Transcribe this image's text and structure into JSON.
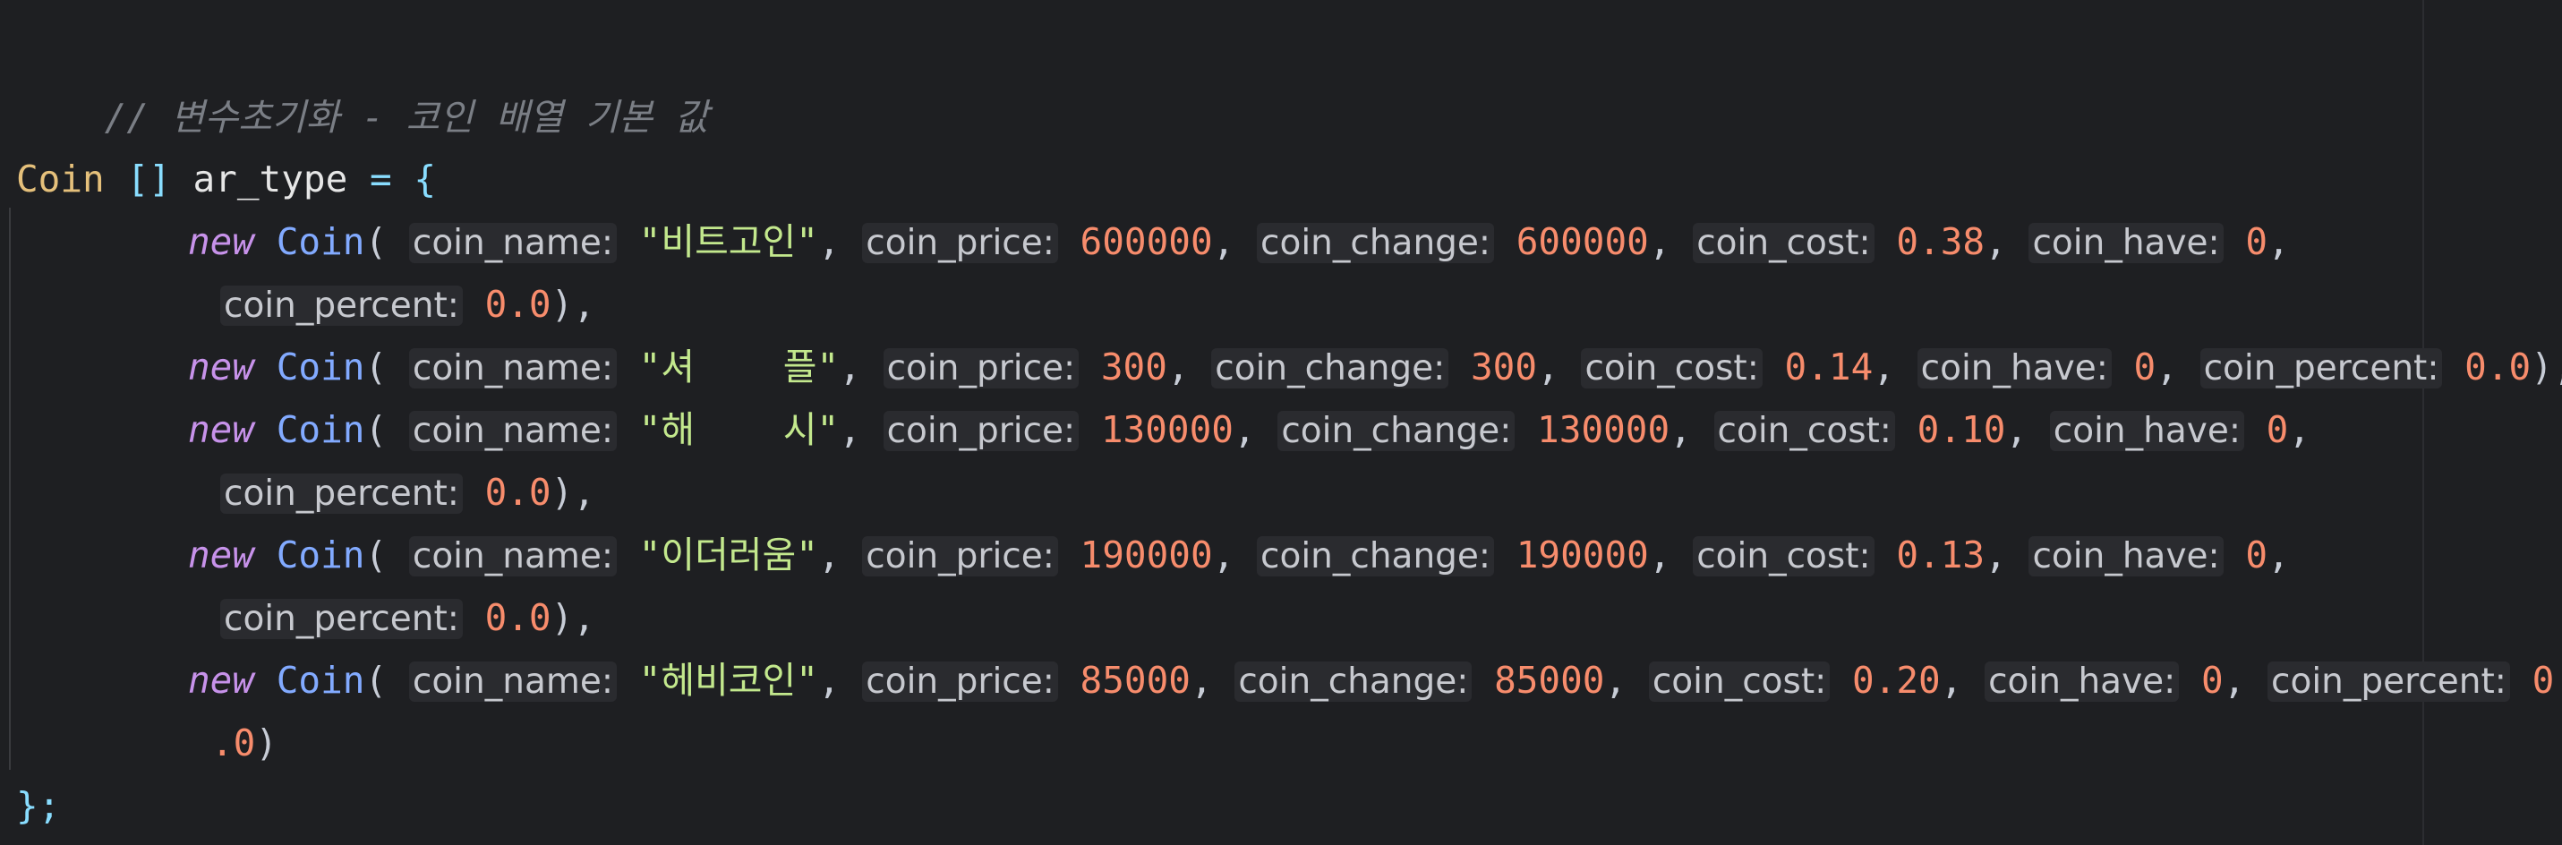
{
  "comment": "// 변수초기화 - 코인 배열 기본 값",
  "decl": {
    "type": "Coin",
    "brackets": "[]",
    "name": "ar_type",
    "eq": "=",
    "open": "{",
    "close": "};"
  },
  "keywords": {
    "new": "new",
    "cls": "Coin"
  },
  "hints": {
    "name": "coin_name:",
    "price": "coin_price:",
    "change": "coin_change:",
    "cost": "coin_cost:",
    "have": "coin_have:",
    "percent": "coin_percent:"
  },
  "coins": [
    {
      "name": "\"비트고인\"",
      "price": "600000",
      "change": "600000",
      "cost": "0.38",
      "have": "0",
      "percent": "0.0"
    },
    {
      "name": "\"셔    플\"",
      "price": "300",
      "change": "300",
      "cost": "0.14",
      "have": "0",
      "percent": "0.0"
    },
    {
      "name": "\"해    시\"",
      "price": "130000",
      "change": "130000",
      "cost": "0.10",
      "have": "0",
      "percent": "0.0"
    },
    {
      "name": "\"이더러움\"",
      "price": "190000",
      "change": "190000",
      "cost": "0.13",
      "have": "0",
      "percent": "0.0"
    },
    {
      "name": "\"헤비코인\"",
      "price": "85000",
      "change": "85000",
      "cost": "0.20",
      "have": "0",
      "percent_part1": "0",
      "percent_part2": ".0"
    }
  ]
}
